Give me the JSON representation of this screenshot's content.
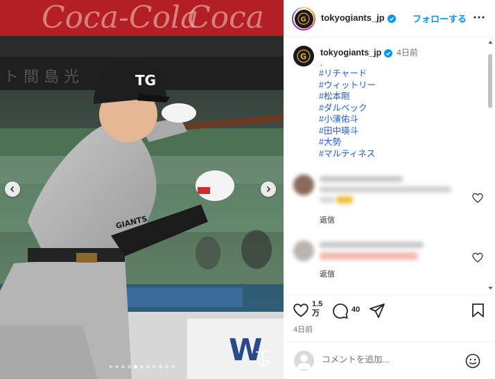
{
  "post": {
    "username": "tokyogiants_jp",
    "follow_label": "フォローする",
    "time_ago": "4日前",
    "caption_first_line": ".",
    "hashtags": [
      "#リチャード",
      "#ウィットリー",
      "#松本剛",
      "#ダルベック",
      "#小濱佑斗",
      "#田中瑛斗",
      "#大勢",
      "#マルティネス"
    ]
  },
  "comments": [
    {
      "reply_label": "返信"
    },
    {
      "reply_label": "返信"
    }
  ],
  "actions": {
    "likes_count": "1.5",
    "likes_unit": "万",
    "comments_count": "40",
    "posted_ago": "4日前"
  },
  "composer": {
    "placeholder": "コメントを追加..."
  },
  "carousel": {
    "slide_count": 11,
    "active_index": 4
  },
  "media": {
    "banner_text": "Coca-Cola",
    "jersey_text": "GIANTS"
  },
  "colors": {
    "accent": "#0095f6",
    "hashtag": "#1f5cc7",
    "verified": "#0095f6",
    "text_secondary": "#737373"
  },
  "icons": {
    "like": "heart-icon",
    "comment": "speech-bubble-icon",
    "share": "paper-plane-icon",
    "save": "bookmark-icon",
    "emoji": "smiley-icon",
    "more": "three-dots-icon"
  }
}
